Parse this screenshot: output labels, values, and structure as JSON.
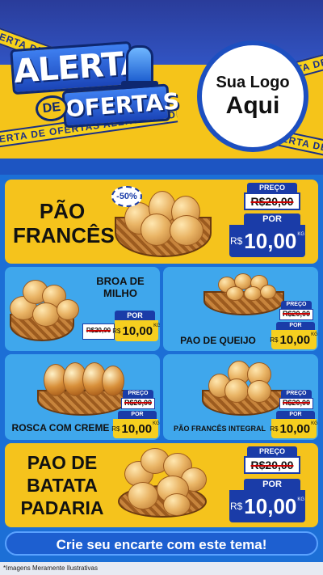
{
  "header": {
    "title_line1": "ALERTA",
    "title_de": "DE",
    "title_line2": "OFERTAS",
    "tape_text": "ALERTA DE OFERTAS ALERTA DE OFERTAS",
    "logo_line1": "Sua Logo",
    "logo_line2": "Aqui"
  },
  "products": [
    {
      "name_lines": [
        "PÃO",
        "FRANCÊS"
      ],
      "discount_badge": "-50%",
      "price_label": "PREÇO",
      "old_price": "R$20,00",
      "por_label": "POR",
      "currency": "R$",
      "new_price": "10,00",
      "unit": "KG"
    },
    {
      "name_lines": [
        "BROA DE",
        "MILHO"
      ],
      "por_label": "POR",
      "old_price": "R$20,00",
      "currency": "R$",
      "new_price": "10,00",
      "unit": "KG"
    },
    {
      "name": "PAO DE QUEIJO",
      "price_label": "PREÇO",
      "old_price": "R$20,00",
      "por_label": "POR",
      "currency": "R$",
      "new_price": "10,00",
      "unit": "KG"
    },
    {
      "name": "ROSCA COM CREME",
      "price_label": "PREÇO",
      "old_price": "R$20,00",
      "por_label": "POR",
      "currency": "R$",
      "new_price": "10,00",
      "unit": "KG"
    },
    {
      "name": "PÃO FRANCÊS INTEGRAL",
      "price_label": "PREÇO",
      "old_price": "R$20,00",
      "por_label": "POR",
      "currency": "R$",
      "new_price": "10,00",
      "unit": "KG"
    },
    {
      "name_lines": [
        "PAO DE",
        "BATATA",
        "PADARIA"
      ],
      "price_label": "PREÇO",
      "old_price": "R$20,00",
      "por_label": "POR",
      "currency": "R$",
      "new_price": "10,00",
      "unit": "KG"
    }
  ],
  "footer": {
    "cta": "Crie seu encarte com este tema!",
    "disclaimer": "*Imagens Meramente Ilustrativas"
  },
  "colors": {
    "yellow": "#f5c31c",
    "blue": "#1a3ca8",
    "light_blue": "#3fa7ec"
  }
}
